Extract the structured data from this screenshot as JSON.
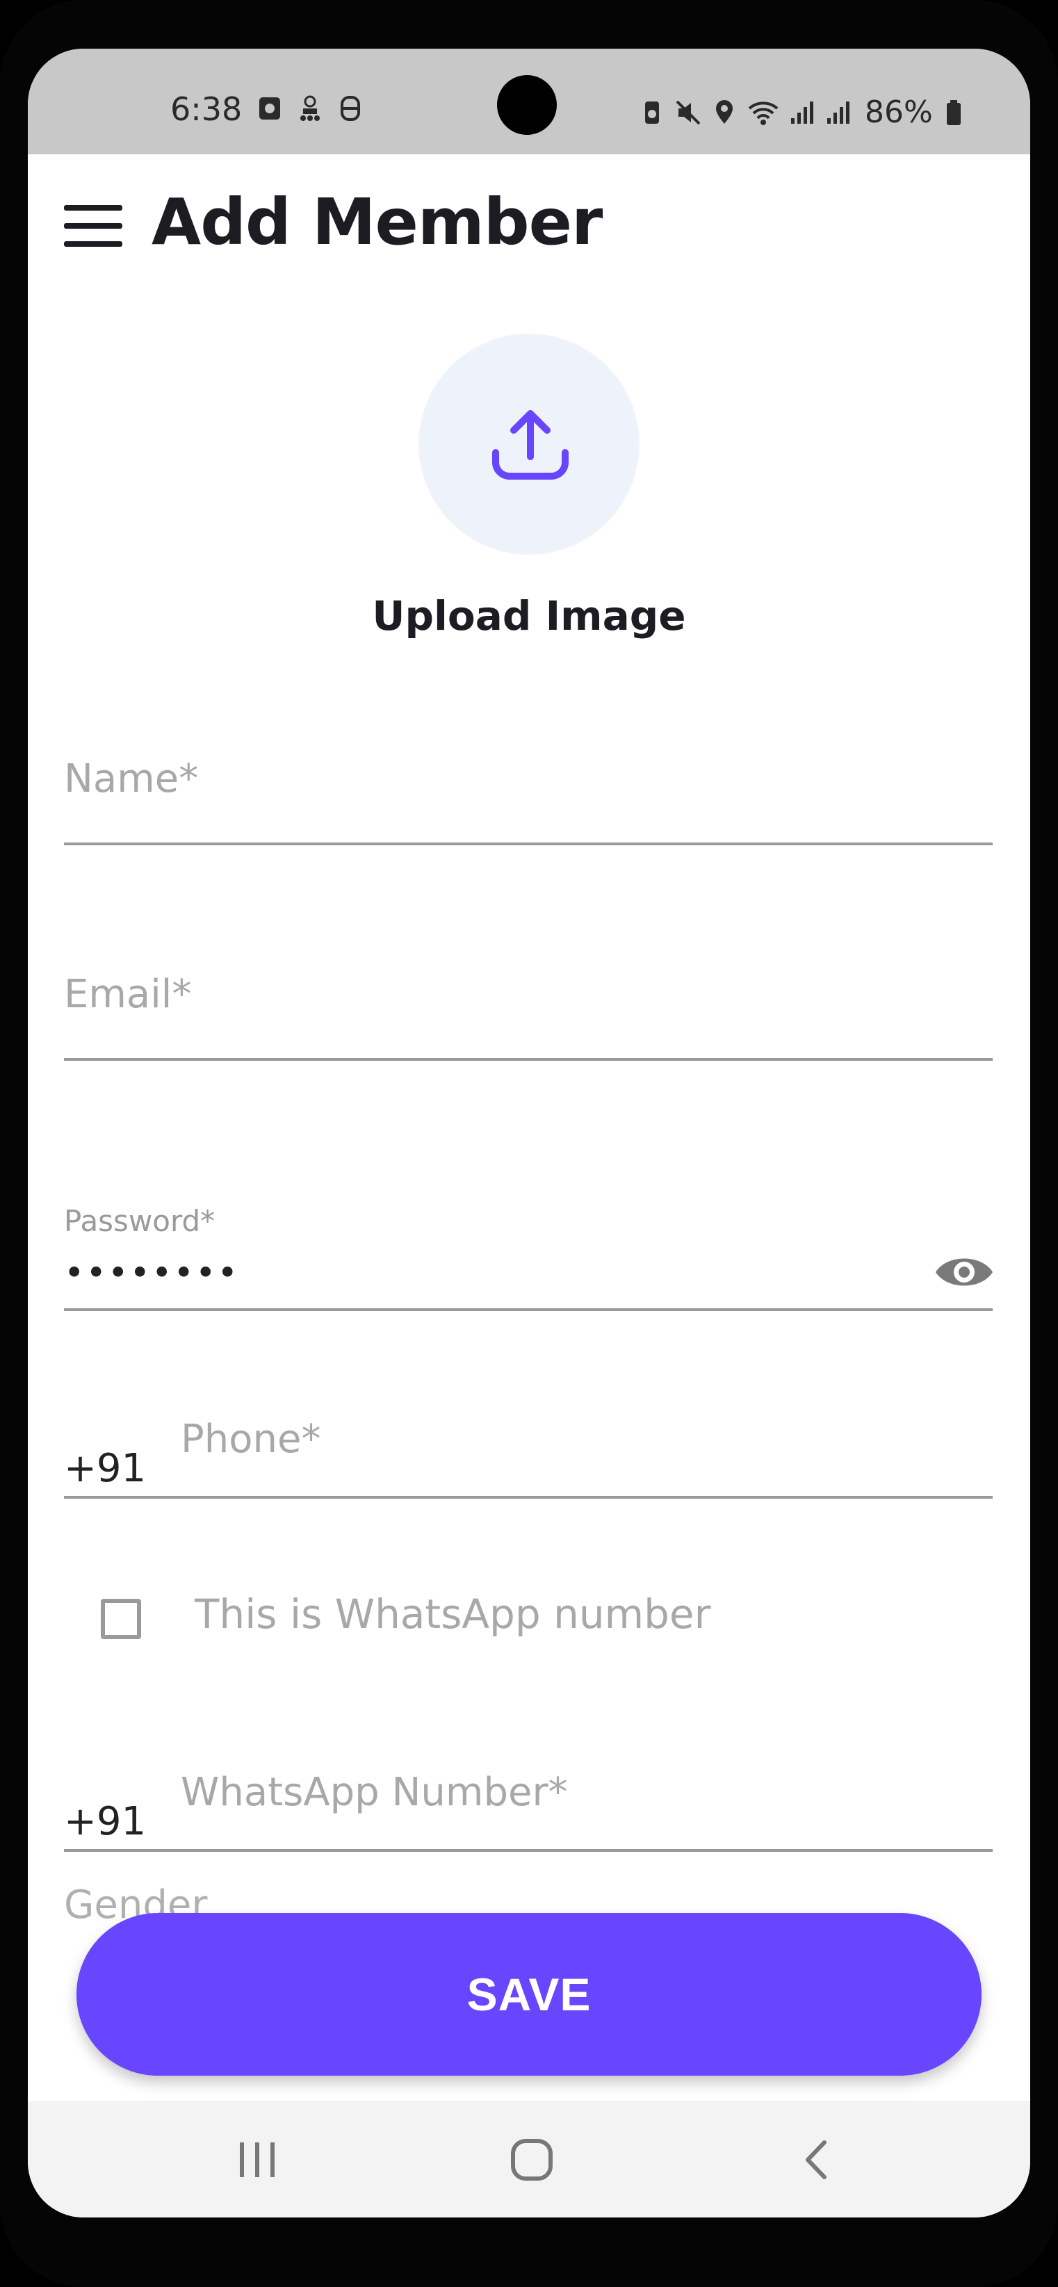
{
  "status_bar": {
    "time": "6:38",
    "battery_percent": "86%",
    "icons_left": [
      "notification-app-icon",
      "robot-icon",
      "carrier-app-icon"
    ],
    "icons_right": [
      "battery-saver-icon",
      "mute-icon",
      "location-icon",
      "wifi-icon",
      "signal-icon",
      "signal-icon",
      "battery-icon"
    ]
  },
  "header": {
    "title": "Add Member",
    "menu_icon": "hamburger-menu-icon"
  },
  "upload": {
    "label": "Upload Image",
    "icon": "upload-icon",
    "accent": "#6845fe"
  },
  "form": {
    "name": {
      "placeholder": "Name*"
    },
    "email": {
      "placeholder": "Email*"
    },
    "password": {
      "label": "Password*",
      "value": "••••••••"
    },
    "phone": {
      "prefix": "+91",
      "placeholder": "Phone*"
    },
    "whatsapp_checkbox": {
      "label": "This is WhatsApp number",
      "checked": false
    },
    "whatsapp": {
      "prefix": "+91",
      "placeholder": "WhatsApp Number*"
    },
    "gender": {
      "label": "Gender"
    }
  },
  "save_button": {
    "label": "SAVE",
    "color": "#6845fe"
  },
  "nav_bar": {
    "icons": [
      "recent-apps-icon",
      "home-icon",
      "back-icon"
    ]
  }
}
